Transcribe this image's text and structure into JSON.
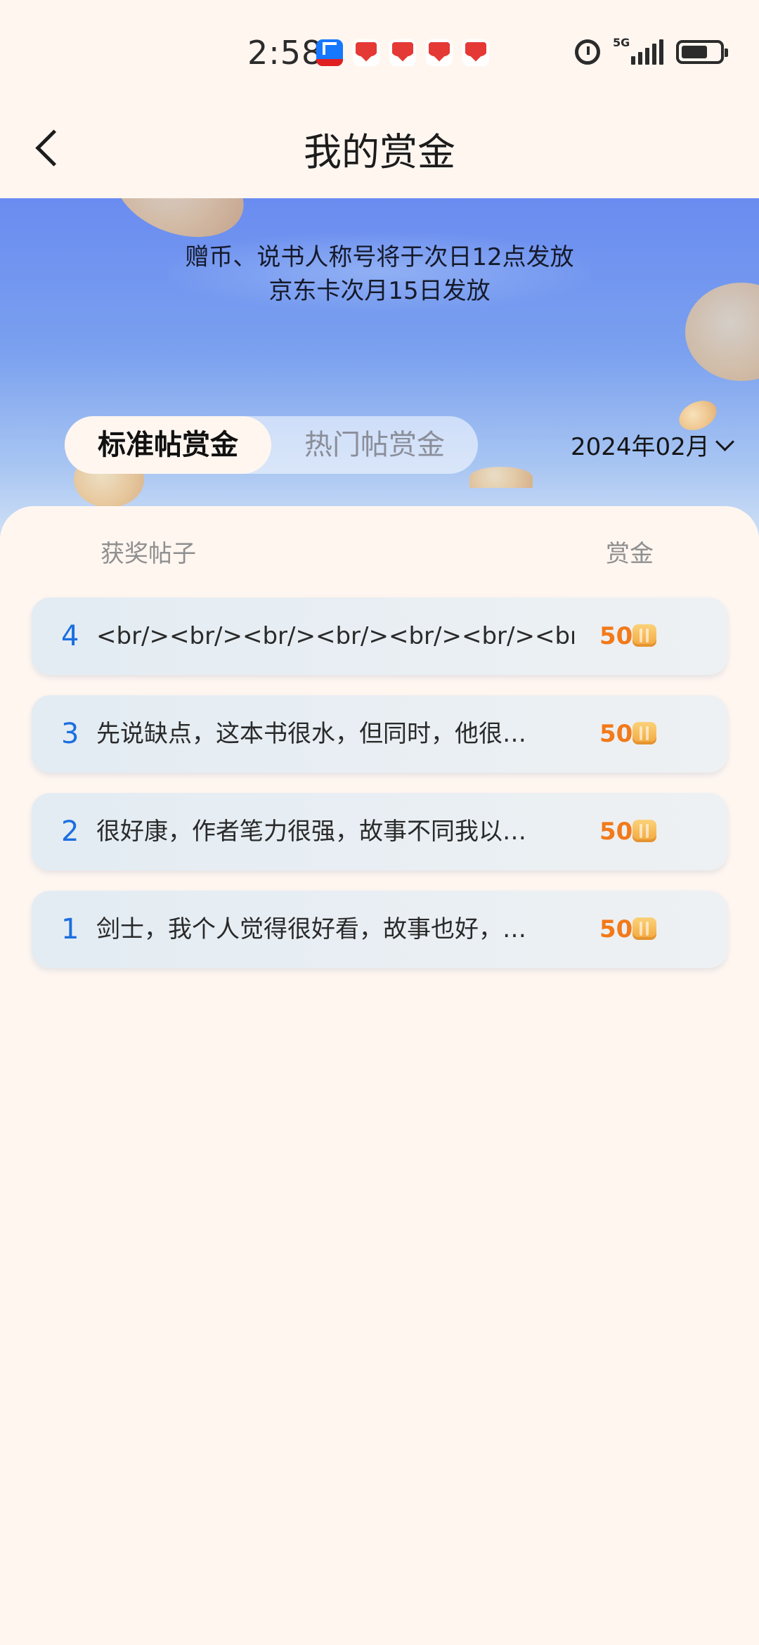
{
  "status_bar": {
    "time": "2:58",
    "network": "5G"
  },
  "header": {
    "title": "我的赏金"
  },
  "notice": {
    "line1": "赠币、说书人称号将于次日12点发放",
    "line2": "京东卡次月15日发放"
  },
  "tabs": [
    {
      "label": "标准帖赏金",
      "active": true
    },
    {
      "label": "热门帖赏金",
      "active": false
    }
  ],
  "month_selector": {
    "value": "2024年02月"
  },
  "list_header": {
    "post": "获奖帖子",
    "reward": "赏金"
  },
  "rewards": [
    {
      "rank": "4",
      "title": "<br/><br/><br/><br/><br/><br/><br/>…",
      "amount": "50"
    },
    {
      "rank": "3",
      "title": "先说缺点，这本书很水，但同时，他很…",
      "amount": "50"
    },
    {
      "rank": "2",
      "title": "很好康，作者笔力很强，故事不同我以…",
      "amount": "50"
    },
    {
      "rank": "1",
      "title": "剑士，我个人觉得很好看，故事也好，…",
      "amount": "50"
    }
  ],
  "colors": {
    "accent_blue": "#1a6fe0",
    "reward_orange": "#f27a1a",
    "page_background": "#fff6f0"
  }
}
